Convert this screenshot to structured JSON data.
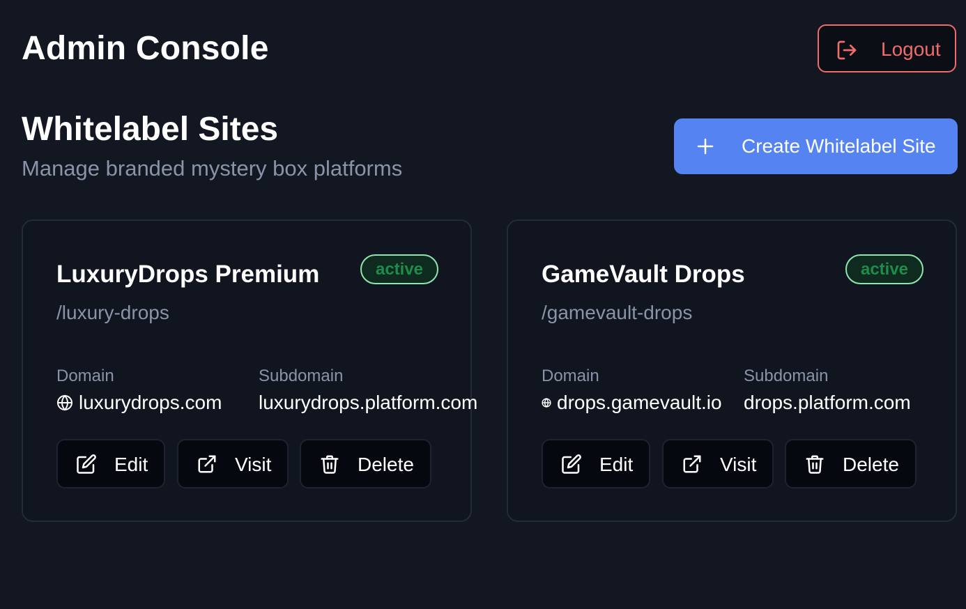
{
  "header": {
    "title": "Admin Console",
    "logout_label": "Logout"
  },
  "section": {
    "title": "Whitelabel Sites",
    "subtitle": "Manage branded mystery box platforms",
    "create_label": "Create Whitelabel Site"
  },
  "sites": [
    {
      "name": "LuxuryDrops Premium",
      "status": "active",
      "slug": "/luxury-drops",
      "domain_label": "Domain",
      "domain": "luxurydrops.com",
      "subdomain_label": "Subdomain",
      "subdomain": "luxurydrops.platform.com",
      "edit_label": "Edit",
      "visit_label": "Visit",
      "delete_label": "Delete"
    },
    {
      "name": "GameVault Drops",
      "status": "active",
      "slug": "/gamevault-drops",
      "domain_label": "Domain",
      "domain": "drops.gamevault.io",
      "subdomain_label": "Subdomain",
      "subdomain": "drops.platform.com",
      "edit_label": "Edit",
      "visit_label": "Visit",
      "delete_label": "Delete"
    }
  ],
  "colors": {
    "background": "#131722",
    "accent": "#5584f2",
    "danger": "#f26b6b",
    "status_active_text": "#1e8c4a",
    "status_active_border": "#8ee6b0",
    "muted_text": "#8a94a8"
  },
  "icons": {
    "logout": "logout-icon",
    "create": "plus-icon",
    "domain": "globe-icon",
    "edit": "edit-icon",
    "visit": "external-link-icon",
    "delete": "trash-icon"
  }
}
